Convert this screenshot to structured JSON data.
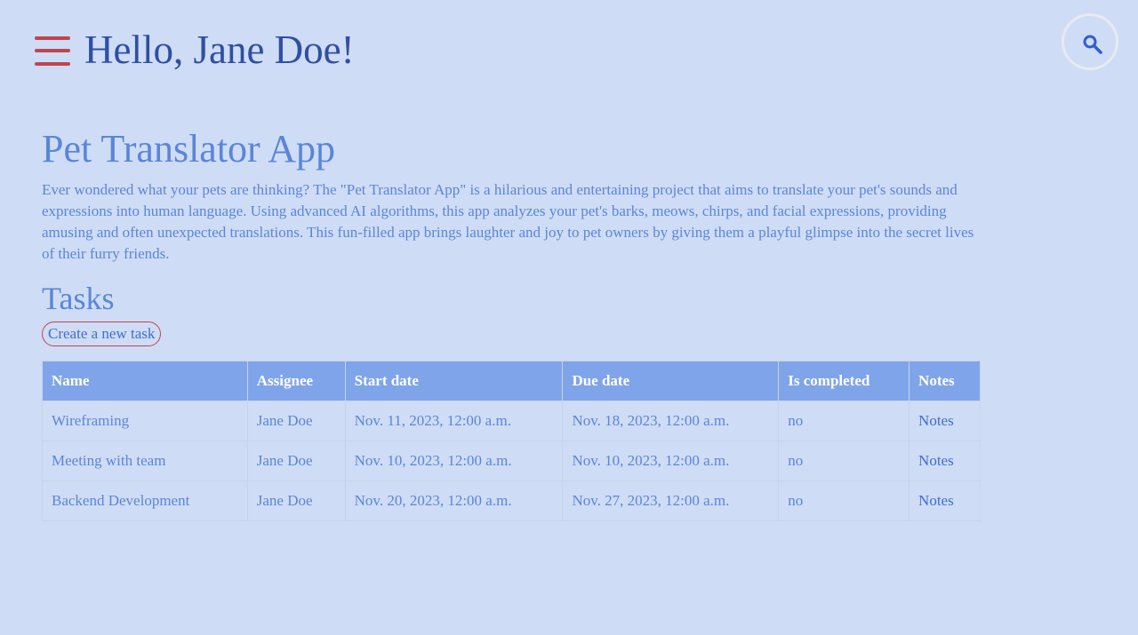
{
  "header": {
    "greeting": "Hello, Jane Doe!",
    "menu_icon": "hamburger-menu-icon",
    "search_icon": "search-icon"
  },
  "project": {
    "title": "Pet Translator App",
    "description": "Ever wondered what your pets are thinking? The \"Pet Translator App\" is a hilarious and entertaining project that aims to translate your pet's sounds and expressions into human language. Using advanced AI algorithms, this app analyzes your pet's barks, meows, chirps, and facial expressions, providing amusing and often unexpected translations. This fun-filled app brings laughter and joy to pet owners by giving them a playful glimpse into the secret lives of their furry friends."
  },
  "tasks": {
    "heading": "Tasks",
    "create_label": "Create a new task",
    "columns": [
      "Name",
      "Assignee",
      "Start date",
      "Due date",
      "Is completed",
      "Notes"
    ],
    "rows": [
      {
        "name": "Wireframing",
        "assignee": "Jane Doe",
        "start": "Nov. 11, 2023, 12:00 a.m.",
        "due": "Nov. 18, 2023, 12:00 a.m.",
        "completed": "no",
        "notes": "Notes"
      },
      {
        "name": "Meeting with team",
        "assignee": "Jane Doe",
        "start": "Nov. 10, 2023, 12:00 a.m.",
        "due": "Nov. 10, 2023, 12:00 a.m.",
        "completed": "no",
        "notes": "Notes"
      },
      {
        "name": "Backend Development",
        "assignee": "Jane Doe",
        "start": "Nov. 20, 2023, 12:00 a.m.",
        "due": "Nov. 27, 2023, 12:00 a.m.",
        "completed": "no",
        "notes": "Notes"
      }
    ]
  },
  "colors": {
    "background": "#cfdcf5",
    "accent_red": "#c0454f",
    "header_text": "#2f4fa3",
    "body_text": "#5a86d9",
    "link": "#3e6ed2",
    "table_header": "#80a4ea"
  }
}
